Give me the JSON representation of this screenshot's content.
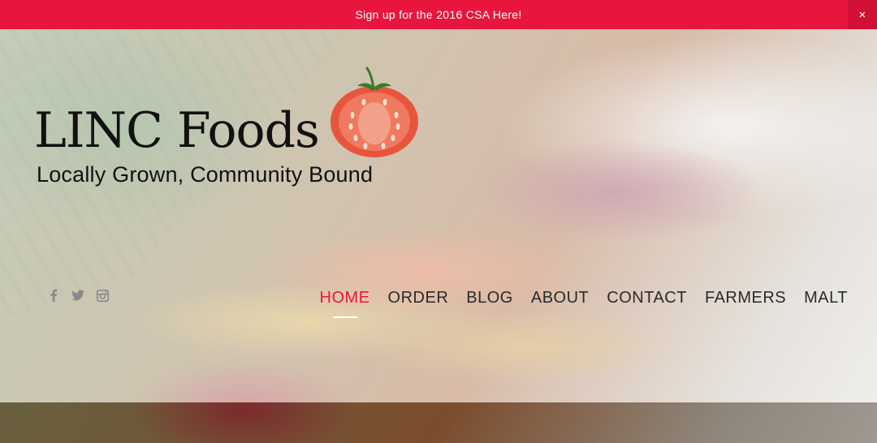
{
  "announcement": {
    "text": "Sign up for the 2016 CSA Here!",
    "close_label": "×"
  },
  "logo": {
    "name_text": "LINC Foods",
    "tagline": "Locally Grown, Community Bound"
  },
  "social": [
    {
      "icon": "facebook-icon",
      "glyph": "f"
    },
    {
      "icon": "twitter-icon",
      "glyph": "twitter"
    },
    {
      "icon": "instagram-icon",
      "glyph": "instagram"
    }
  ],
  "nav": {
    "items": [
      {
        "label": "HOME",
        "active": true
      },
      {
        "label": "ORDER"
      },
      {
        "label": "BLOG"
      },
      {
        "label": "ABOUT"
      },
      {
        "label": "CONTACT"
      },
      {
        "label": "FARMERS"
      },
      {
        "label": "MALT"
      }
    ]
  },
  "colors": {
    "accent": "#e8163f",
    "nav_text": "#2a2a2a",
    "social_icon": "#8a8a8a"
  }
}
